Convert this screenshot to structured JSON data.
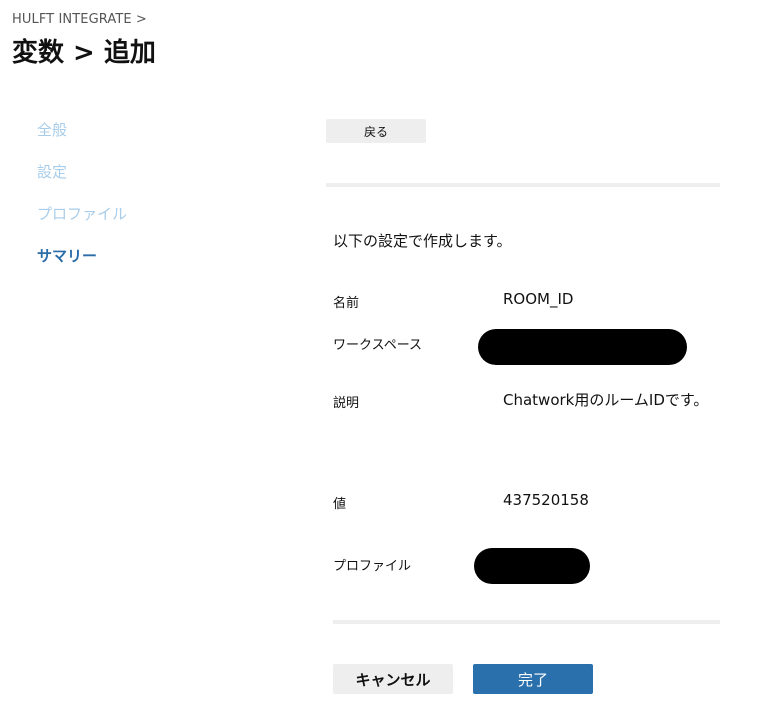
{
  "breadcrumb": {
    "root": "HULFT INTEGRATE",
    "separator": ">"
  },
  "page_title": "変数 > 追加",
  "side_nav": {
    "items": [
      {
        "label": "全般",
        "active": false
      },
      {
        "label": "設定",
        "active": false
      },
      {
        "label": "プロファイル",
        "active": false
      },
      {
        "label": "サマリー",
        "active": true
      }
    ]
  },
  "back_button": "戻る",
  "intro": "以下の設定で作成します。",
  "fields": {
    "name": {
      "label": "名前",
      "value": "ROOM_ID"
    },
    "workspace": {
      "label": "ワークスペース",
      "value_redacted": true
    },
    "description": {
      "label": "説明",
      "value": "Chatwork用のルームIDです。"
    },
    "value": {
      "label": "値",
      "value": "437520158"
    },
    "profile": {
      "label": "プロファイル",
      "value_redacted": true
    }
  },
  "footer": {
    "cancel": "キャンセル",
    "done": "完了"
  },
  "colors": {
    "accent": "#2a70ad",
    "nav_inactive": "#a8cdea",
    "nav_active": "#2a6ca8",
    "button_gray": "#eeeeee"
  }
}
